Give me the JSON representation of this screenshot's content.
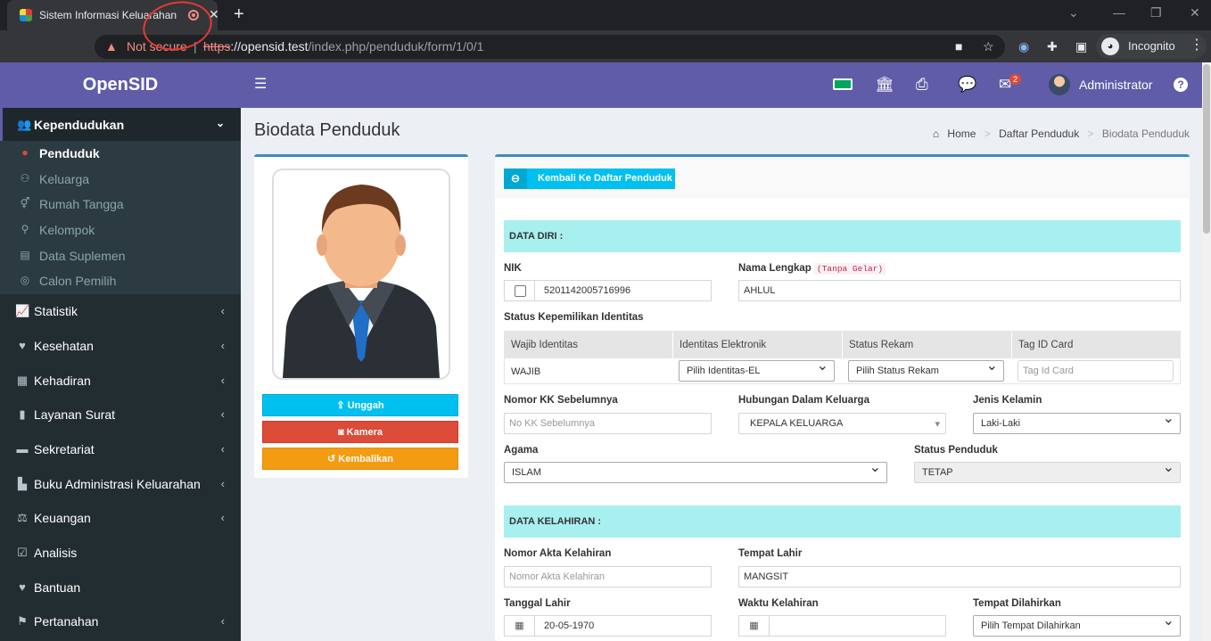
{
  "browser": {
    "tab_title": "Sistem Informasi Keluarahan",
    "url_scheme": "https",
    "url_rest": "://opensid.test",
    "url_path": "/index.php/penduduk/form/1/0/1",
    "security_text": "Not secure",
    "incognito_label": "Incognito"
  },
  "app": {
    "logo": "OpenSID",
    "user": "Administrator",
    "mail_badge": "2"
  },
  "sidebar": {
    "active_menu": {
      "label": "Kependudukan",
      "icon": "users-icon"
    },
    "submenu": [
      {
        "label": "Penduduk",
        "icon": "user-icon",
        "active": true
      },
      {
        "label": "Keluarga",
        "icon": "users-icon"
      },
      {
        "label": "Rumah Tangga",
        "icon": "venus-mars-icon"
      },
      {
        "label": "Kelompok",
        "icon": "sitemap-icon"
      },
      {
        "label": "Data Suplemen",
        "icon": "database-icon"
      },
      {
        "label": "Calon Pemilih",
        "icon": "podcast-icon"
      }
    ],
    "items": [
      {
        "label": "Statistik",
        "icon": "chart-icon"
      },
      {
        "label": "Kesehatan",
        "icon": "heartbeat-icon"
      },
      {
        "label": "Kehadiran",
        "icon": "calendar-check-icon"
      },
      {
        "label": "Layanan Surat",
        "icon": "book-icon"
      },
      {
        "label": "Sekretariat",
        "icon": "archive-icon"
      },
      {
        "label": "Buku Administrasi Keluarahan",
        "icon": "file-icon"
      },
      {
        "label": "Keuangan",
        "icon": "balance-scale-icon"
      },
      {
        "label": "Analisis",
        "icon": "check-square-icon"
      },
      {
        "label": "Bantuan",
        "icon": "heart-icon"
      },
      {
        "label": "Pertanahan",
        "icon": "map-signs-icon"
      }
    ]
  },
  "page": {
    "title": "Biodata Penduduk",
    "breadcrumb": [
      "Home",
      "Daftar Penduduk",
      "Biodata Penduduk"
    ]
  },
  "photo_box": {
    "upload": "Unggah",
    "camera": "Kamera",
    "reset": "Kembalikan"
  },
  "form": {
    "back_button": "Kembali Ke Daftar Penduduk",
    "section_data_diri": "DATA DIRI :",
    "nik_label": "NIK",
    "nik_value": "5201142005716996",
    "nama_label": "Nama Lengkap",
    "nama_hint": "(Tanpa Gelar)",
    "nama_value": "AHLUL",
    "status_kepemilikan_label": "Status Kepemilikan Identitas",
    "id_table": {
      "headers": [
        "Wajib Identitas",
        "Identitas Elektronik",
        "Status Rekam",
        "Tag ID Card"
      ],
      "wajib": "WAJIB",
      "identitas_el": "Pilih Identitas-EL",
      "status_rekam": "Pilih Status Rekam",
      "tag_placeholder": "Tag Id Card"
    },
    "no_kk_label": "Nomor KK Sebelumnya",
    "no_kk_placeholder": "No KK Sebelumnya",
    "hubungan_label": "Hubungan Dalam Keluarga",
    "hubungan_value": "KEPALA KELUARGA",
    "jenis_kelamin_label": "Jenis Kelamin",
    "jenis_kelamin_value": "Laki-Laki",
    "agama_label": "Agama",
    "agama_value": "ISLAM",
    "status_penduduk_label": "Status Penduduk",
    "status_penduduk_value": "TETAP",
    "section_kelahiran": "DATA KELAHIRAN :",
    "akta_label": "Nomor Akta Kelahiran",
    "akta_placeholder": "Nomor Akta Kelahiran",
    "tempat_lahir_label": "Tempat Lahir",
    "tempat_lahir_value": "MANGSIT",
    "tanggal_lahir_label": "Tanggal Lahir",
    "tanggal_lahir_value": "20-05-1970",
    "waktu_label": "Waktu Kelahiran",
    "tempat_dilahirkan_label": "Tempat Dilahirkan",
    "tempat_dilahirkan_value": "Pilih Tempat Dilahirkan"
  }
}
